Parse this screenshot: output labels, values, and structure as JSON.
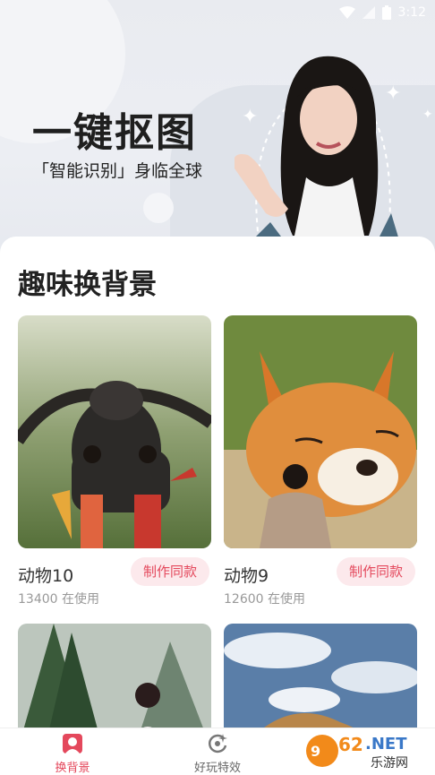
{
  "status_bar": {
    "time": "3:12"
  },
  "hero": {
    "title": "一键抠图",
    "subtitle": "「智能识别」身临全球"
  },
  "section": {
    "title": "趣味换背景"
  },
  "cards": [
    {
      "name": "动物10",
      "usage": "13400 在使用",
      "action": "制作同款"
    },
    {
      "name": "动物9",
      "usage": "12600 在使用",
      "action": "制作同款"
    },
    {
      "name": "",
      "usage": "",
      "action": ""
    },
    {
      "name": "",
      "usage": "",
      "action": ""
    }
  ],
  "bottom_nav": {
    "items": [
      {
        "label": "换背景",
        "icon": "portrait-icon",
        "active": true
      },
      {
        "label": "好玩特效",
        "icon": "sparkle-refresh-icon",
        "active": false
      }
    ]
  },
  "watermark": {
    "text": "962.NET",
    "sub": "乐游网"
  },
  "colors": {
    "accent": "#e4485c",
    "accent_bg": "#fce9ec",
    "active_tab": "#e4485c"
  }
}
